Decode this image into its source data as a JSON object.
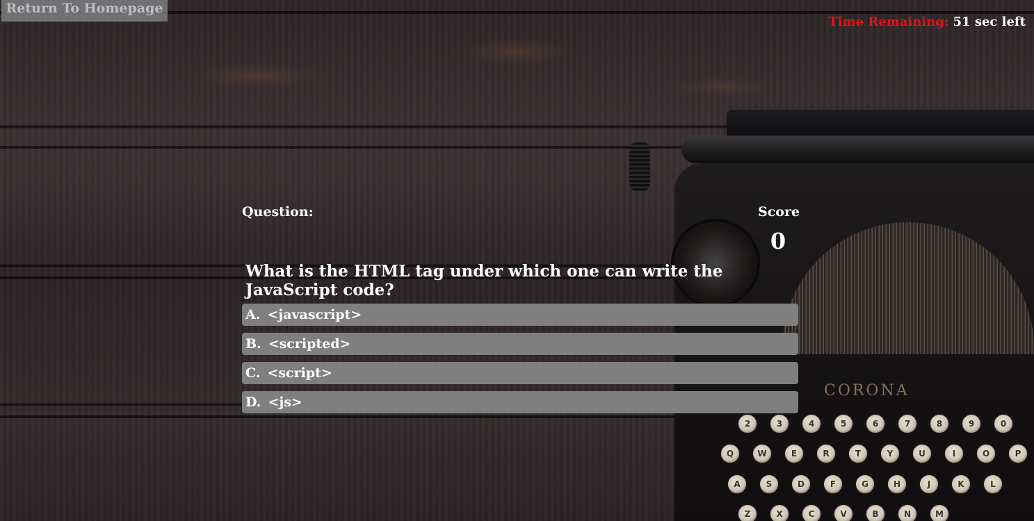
{
  "nav": {
    "home_label": "Return To Homepage"
  },
  "timer": {
    "label": "Time Remaining:",
    "value": "51 sec left"
  },
  "quiz": {
    "question_label": "Question:",
    "score_label": "Score",
    "score_value": "0",
    "question_text": "What is the HTML tag under which one can write the JavaScript code?",
    "answers": [
      {
        "letter": "A.",
        "text": "<javascript>"
      },
      {
        "letter": "B.",
        "text": "<scripted>"
      },
      {
        "letter": "C.",
        "text": "<script>"
      },
      {
        "letter": "D.",
        "text": "<js>"
      }
    ]
  },
  "background": {
    "brand_text": "CORONA",
    "keys_row1": [
      "2",
      "3",
      "4",
      "5",
      "6",
      "7",
      "8",
      "9",
      "0"
    ],
    "keys_row2": [
      "Q",
      "W",
      "E",
      "R",
      "T",
      "Y",
      "U",
      "I",
      "O",
      "P"
    ],
    "keys_row3": [
      "A",
      "S",
      "D",
      "F",
      "G",
      "H",
      "J",
      "K",
      "L"
    ],
    "keys_row4": [
      "Z",
      "X",
      "C",
      "V",
      "B",
      "N",
      "M"
    ]
  },
  "colors": {
    "timer_label": "#e3141c",
    "answer_bg": "#7f7f7f",
    "home_btn_bg": "#7d7f82"
  }
}
